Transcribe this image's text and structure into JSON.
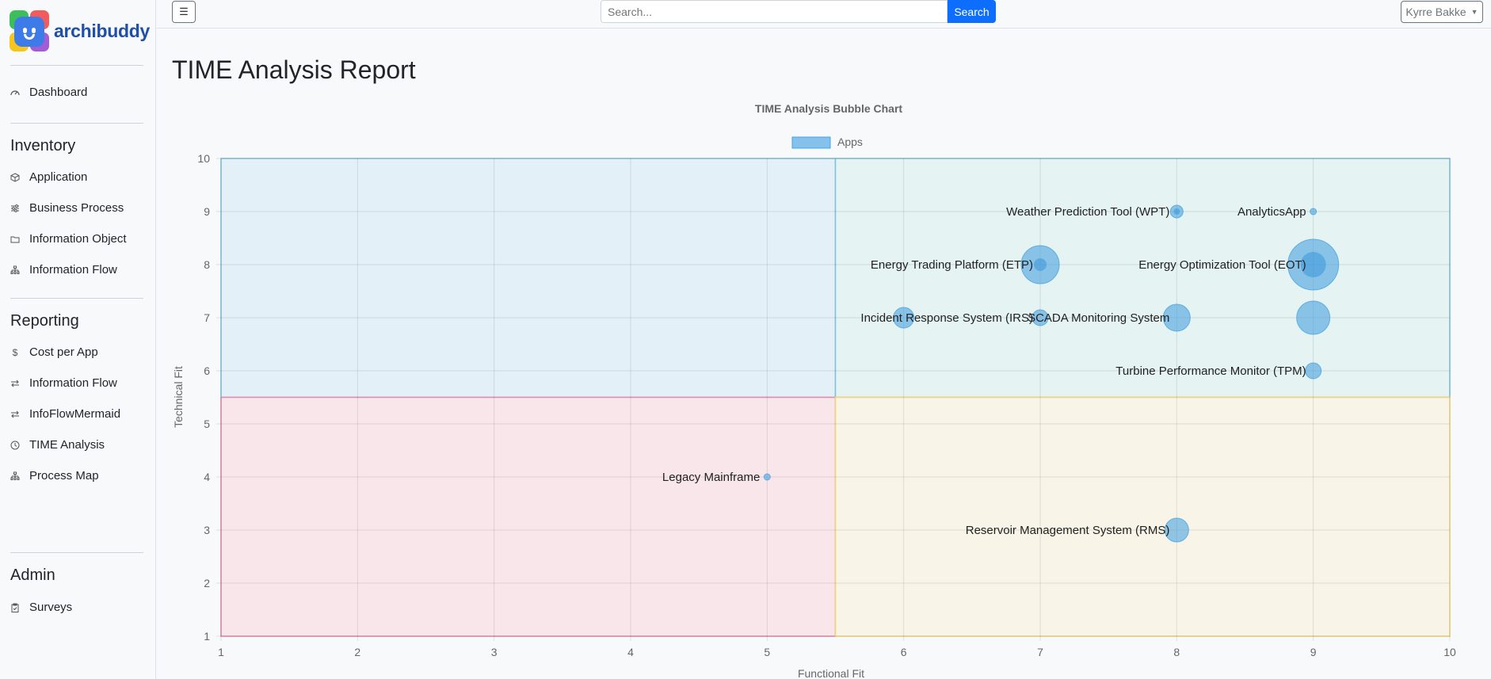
{
  "brand": {
    "name": "archibuddy"
  },
  "sidebar": {
    "dashboard": "Dashboard",
    "sections": [
      {
        "heading": "Inventory",
        "items": [
          {
            "label": "Application",
            "icon": "box-icon"
          },
          {
            "label": "Business Process",
            "icon": "sliders-icon"
          },
          {
            "label": "Information Object",
            "icon": "folder-icon"
          },
          {
            "label": "Information Flow",
            "icon": "diagram-icon"
          }
        ]
      },
      {
        "heading": "Reporting",
        "items": [
          {
            "label": "Cost per App",
            "icon": "dollar-icon"
          },
          {
            "label": "Information Flow",
            "icon": "arrows-icon"
          },
          {
            "label": "InfoFlowMermaid",
            "icon": "arrows-icon"
          },
          {
            "label": "TIME Analysis",
            "icon": "clock-icon"
          },
          {
            "label": "Process Map",
            "icon": "diagram-icon"
          }
        ]
      },
      {
        "heading": "Admin",
        "items": [
          {
            "label": "Surveys",
            "icon": "clipboard-icon"
          }
        ]
      }
    ]
  },
  "topbar": {
    "menu_icon": "☰",
    "search_placeholder": "Search...",
    "search_button": "Search",
    "user_name": "Kyrre Bakke"
  },
  "page": {
    "title": "TIME Analysis Report"
  },
  "chart_data": {
    "type": "bubble",
    "title": "TIME Analysis Bubble Chart",
    "xlabel": "Functional Fit",
    "ylabel": "Technical Fit",
    "xlim": [
      1,
      10
    ],
    "ylim": [
      1,
      10
    ],
    "xticks": [
      "1",
      "2",
      "3",
      "4",
      "5",
      "6",
      "7",
      "8",
      "9",
      "10"
    ],
    "yticks": [
      "1",
      "2",
      "3",
      "4",
      "5",
      "6",
      "7",
      "8",
      "9",
      "10"
    ],
    "grid": true,
    "legend": {
      "position": "top",
      "entries": [
        "Apps"
      ]
    },
    "quadrant_split": {
      "x": 5.5,
      "y": 5.5
    },
    "quadrant_colors": {
      "top_left": "#e3f0f8",
      "top_right": "#e5f3f2",
      "bottom_left": "#f9e6ea",
      "bottom_right": "#f8f4e7",
      "top_left_border": "#7fc3d9",
      "top_right_border": "#7fc3d9",
      "bottom_left_border": "#e08aa6",
      "bottom_right_border": "#f0d27a"
    },
    "bubble_color": "#4aa3df",
    "series": [
      {
        "name": "Apps",
        "points": [
          {
            "label": "Weather Prediction Tool (WPT)",
            "x": 8,
            "y": 9,
            "r": 8,
            "bubble": "wpt"
          },
          {
            "label": "AnalyticsApp",
            "x": 9,
            "y": 9,
            "r": 4,
            "bubble": "analytics"
          },
          {
            "label": "Energy Trading Platform (ETP)",
            "x": 7,
            "y": 8,
            "r": 24,
            "bubble": "etp"
          },
          {
            "label": "Energy Optimization Tool (EOT)",
            "x": 9,
            "y": 8,
            "r": 32,
            "bubble": "eot"
          },
          {
            "label": "Incident Response System (IRS)",
            "x": 7,
            "y": 7,
            "r": 10,
            "bubble": "irs"
          },
          {
            "label": "",
            "x": 6,
            "y": 7,
            "r": 13,
            "bubble": "irs-large"
          },
          {
            "label": "SCADA Monitoring System",
            "x": 8,
            "y": 7,
            "r": 17,
            "bubble": "scada"
          },
          {
            "label": "",
            "x": 9,
            "y": 7,
            "r": 21,
            "bubble": "scada-large"
          },
          {
            "label": "Turbine Performance Monitor (TPM)",
            "x": 9,
            "y": 6,
            "r": 10,
            "bubble": "tpm"
          },
          {
            "label": "Legacy Mainframe",
            "x": 5,
            "y": 4,
            "r": 4,
            "bubble": "legacy"
          },
          {
            "label": "Reservoir Management System (RMS)",
            "x": 8,
            "y": 3,
            "r": 15,
            "bubble": "rms"
          }
        ]
      }
    ],
    "overlay_points": [
      {
        "x": 7,
        "y": 8,
        "r": 8
      },
      {
        "x": 9,
        "y": 8,
        "r": 16
      },
      {
        "x": 8,
        "y": 9,
        "r": 4
      }
    ]
  }
}
